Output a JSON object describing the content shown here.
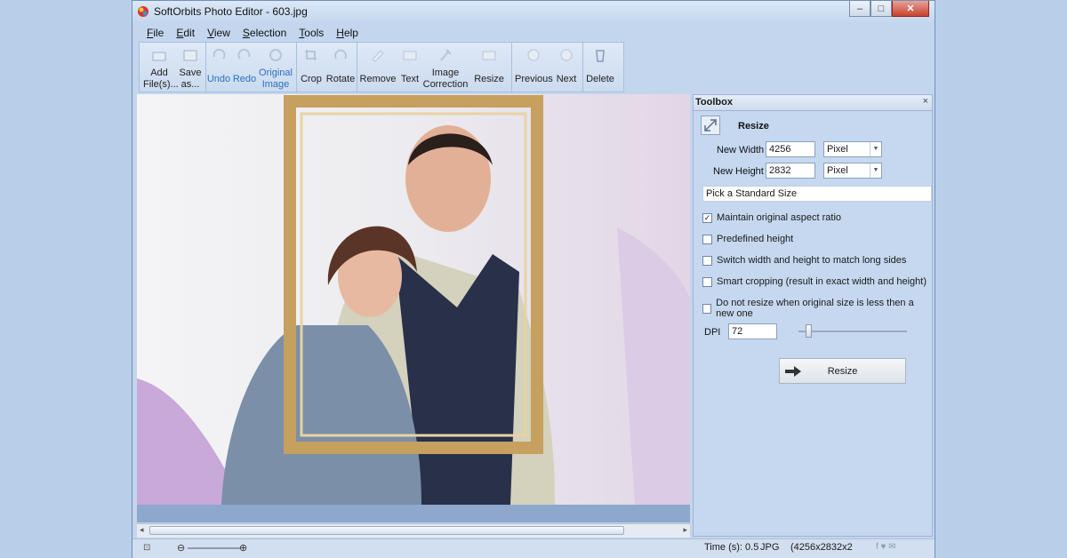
{
  "window": {
    "title": "SoftOrbits Photo Editor - 603.jpg"
  },
  "menu": [
    {
      "label": "File",
      "u": "F",
      "rest": "ile"
    },
    {
      "label": "Edit",
      "u": "E",
      "rest": "dit"
    },
    {
      "label": "View",
      "u": "V",
      "rest": "iew"
    },
    {
      "label": "Selection",
      "u": "S",
      "rest": "election"
    },
    {
      "label": "Tools",
      "u": "T",
      "rest": "ools"
    },
    {
      "label": "Help",
      "u": "H",
      "rest": "elp"
    }
  ],
  "ribbon": {
    "add": "Add\nFile(s)...",
    "save": "Save\nas...",
    "undo": "Undo",
    "redo": "Redo",
    "original": "Original\nImage",
    "crop": "Crop",
    "rotate": "Rotate",
    "remove": "Remove",
    "text": "Text",
    "image_correction": "Image\nCorrection",
    "resize": "Resize",
    "previous": "Previous",
    "next": "Next",
    "delete": "Delete"
  },
  "toolbox": {
    "title": "Toolbox",
    "close": "×",
    "section": "Resize",
    "new_width_label": "New Width",
    "new_width_value": "4256",
    "new_height_label": "New Height",
    "new_height_value": "2832",
    "unit_width": "Pixel",
    "unit_height": "Pixel",
    "standard_size": "Pick a Standard Size",
    "options": [
      {
        "label": "Maintain original aspect ratio",
        "checked": true
      },
      {
        "label": "Predefined height",
        "checked": false
      },
      {
        "label": "Switch width and height to match long sides",
        "checked": false
      },
      {
        "label": "Smart cropping (result in exact width and height)",
        "checked": false
      },
      {
        "label": "Do not resize when original size is less then a new one",
        "checked": false
      }
    ],
    "dpi_label": "DPI",
    "dpi_value": "72",
    "dpi_slider_fraction": 0.07,
    "resize_button": "Resize"
  },
  "status": {
    "time": "Time (s): 0.5",
    "format": "JPG",
    "dimensions": "(4256x2832x2"
  }
}
